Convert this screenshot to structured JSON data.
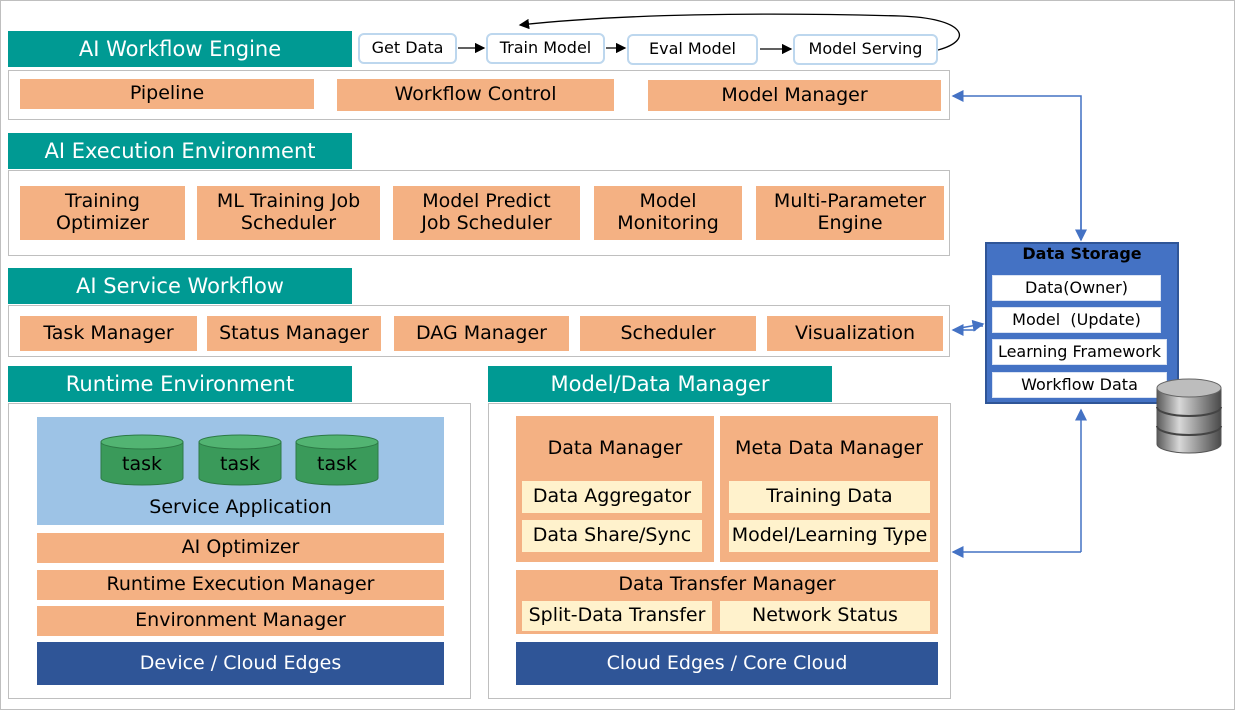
{
  "workflow_engine": {
    "title": "AI Workflow Engine",
    "flow": [
      "Get Data",
      "Train Model",
      "Eval Model",
      "Model Serving"
    ],
    "items": [
      "Pipeline",
      "Workflow Control",
      "Model Manager"
    ]
  },
  "execution_env": {
    "title": "AI Execution Environment",
    "items": [
      "Training\nOptimizer",
      "ML Training Job\nScheduler",
      "Model Predict\nJob Scheduler",
      "Model\nMonitoring",
      "Multi-Parameter\nEngine"
    ]
  },
  "service_workflow": {
    "title": "AI Service Workflow",
    "items": [
      "Task Manager",
      "Status Manager",
      "DAG Manager",
      "Scheduler",
      "Visualization"
    ]
  },
  "runtime_env": {
    "title": "Runtime Environment",
    "tasks": [
      "task",
      "task",
      "task"
    ],
    "service_app": "Service Application",
    "layers": [
      "AI Optimizer",
      "Runtime Execution Manager",
      "Environment Manager"
    ],
    "base": "Device / Cloud Edges"
  },
  "model_data_manager": {
    "title": "Model/Data Manager",
    "data_manager": {
      "title": "Data Manager",
      "items": [
        "Data Aggregator",
        "Data Share/Sync"
      ]
    },
    "meta_data_manager": {
      "title": "Meta Data Manager",
      "items": [
        "Training Data",
        "Model/Learning Type"
      ]
    },
    "data_transfer_manager": {
      "title": "Data Transfer Manager",
      "items": [
        "Split-Data Transfer",
        "Network Status"
      ]
    },
    "base": "Cloud Edges / Core Cloud"
  },
  "data_storage": {
    "title": "Data Storage",
    "items": [
      "Data(Owner)",
      "Model  (Update)",
      "Learning Framework",
      "Workflow Data"
    ],
    "icon": "database-icon"
  },
  "colors": {
    "header": "#009a93",
    "module": "#f4b183",
    "submodule": "#fff2cc",
    "infra": "#2f5597",
    "storage": "#4472c4",
    "arrow": "#4472c4"
  }
}
